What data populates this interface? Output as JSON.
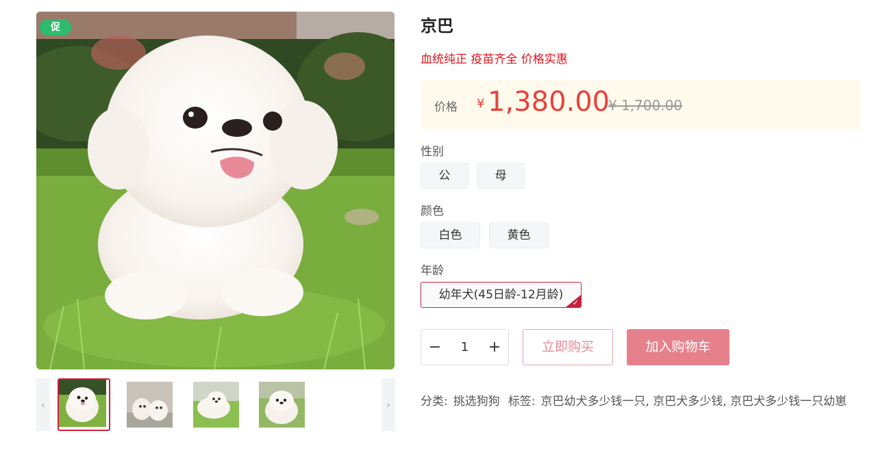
{
  "product": {
    "title": "京巴",
    "slogan": "血统纯正 疫苗齐全 价格实惠",
    "promo_badge": "促"
  },
  "price": {
    "label": "价格",
    "currency": "¥",
    "current": "1,380.00",
    "original": "¥ 1,700.00"
  },
  "options": {
    "gender": {
      "label": "性别",
      "values": [
        "公",
        "母"
      ]
    },
    "color": {
      "label": "颜色",
      "values": [
        "白色",
        "黄色"
      ]
    },
    "age": {
      "label": "年龄",
      "values": [
        "幼年犬(45日龄-12月龄)"
      ],
      "selected": "幼年犬(45日龄-12月龄)"
    }
  },
  "quantity": {
    "minus": "−",
    "value": "1",
    "plus": "+"
  },
  "actions": {
    "buy_now": "立即购买",
    "add_to_cart": "加入购物车"
  },
  "gallery": {
    "prev": "‹",
    "next": "›",
    "thumbnail_count": 4,
    "active_index": 0
  },
  "meta": {
    "category_label": "分类:",
    "category": "挑选狗狗",
    "tags_label": "标签:",
    "tags": [
      "京巴幼犬多少钱一只,",
      "京巴犬多少钱,",
      "京巴犬多少钱一只幼崽"
    ]
  },
  "colors": {
    "accent": "#c8203c",
    "price": "#e8413b",
    "slogan": "#e0141c",
    "promo": "#2dbb6e",
    "price_bg": "#fffaec",
    "cart_button": "#e6818c"
  }
}
